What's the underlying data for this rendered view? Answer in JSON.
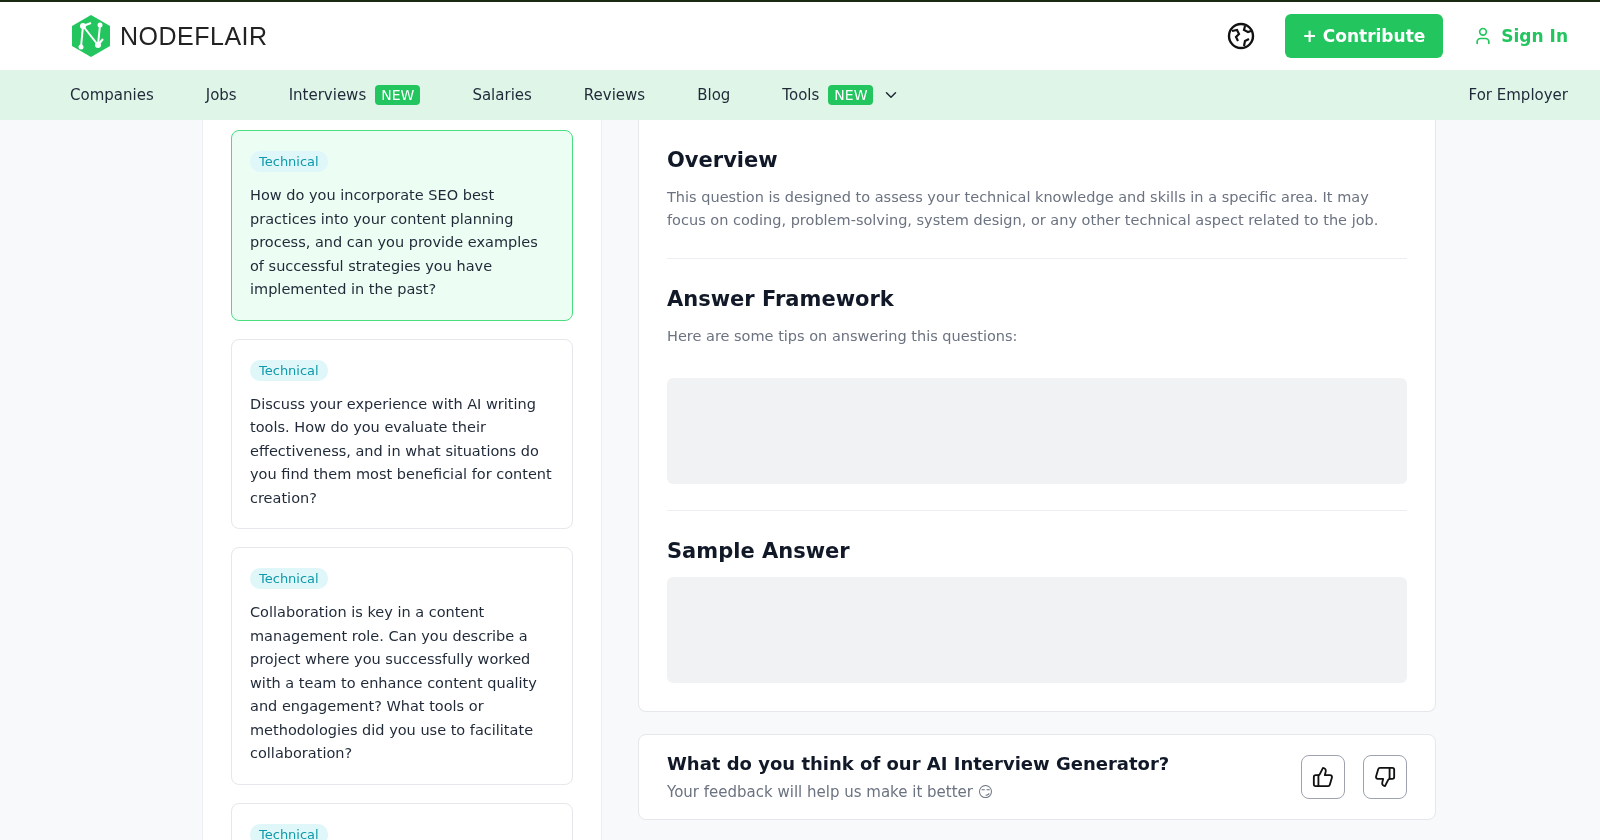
{
  "header": {
    "logo_text": {
      "light": "NODE",
      "bold": "FLAIR"
    },
    "contribute_button": "+ Contribute",
    "sign_in": "Sign In"
  },
  "nav": {
    "items": [
      {
        "label": "Companies",
        "dropdown": false
      },
      {
        "label": "Jobs",
        "dropdown": false
      },
      {
        "label": "Interviews",
        "badge": "NEW",
        "dropdown": false
      },
      {
        "label": "Salaries",
        "dropdown": false
      },
      {
        "label": "Reviews",
        "dropdown": false
      },
      {
        "label": "Blog",
        "dropdown": false
      },
      {
        "label": "Tools",
        "badge": "NEW",
        "dropdown": true
      }
    ],
    "employer_link": "For Employer"
  },
  "questions": [
    {
      "tag": "Technical",
      "text": "How do you incorporate SEO best practices into your content planning process, and can you provide examples of successful strategies you have implemented in the past?",
      "selected": true
    },
    {
      "tag": "Technical",
      "text": "Discuss your experience with AI writing tools. How do you evaluate their effectiveness, and in what situations do you find them most beneficial for content creation?",
      "selected": false
    },
    {
      "tag": "Technical",
      "text": "Collaboration is key in a content management role. Can you describe a project where you successfully worked with a team to enhance content quality and engagement? What tools or methodologies did you use to facilitate collaboration?",
      "selected": false
    },
    {
      "tag": "Technical",
      "selected": false
    }
  ],
  "detail": {
    "sections": [
      {
        "title": "Overview",
        "text": "This question is designed to assess your technical knowledge and skills in a specific area. It may focus on coding, problem-solving, system design, or any other technical aspect related to the job.",
        "loading": false
      },
      {
        "title": "Answer Framework",
        "text": "Here are some tips on answering this questions:",
        "loading": true
      },
      {
        "title": "Sample Answer",
        "loading": true
      }
    ]
  },
  "feedback": {
    "title": "What do you think of our AI Interview Generator?",
    "subtitle": "Your feedback will help us make it better 😏"
  }
}
